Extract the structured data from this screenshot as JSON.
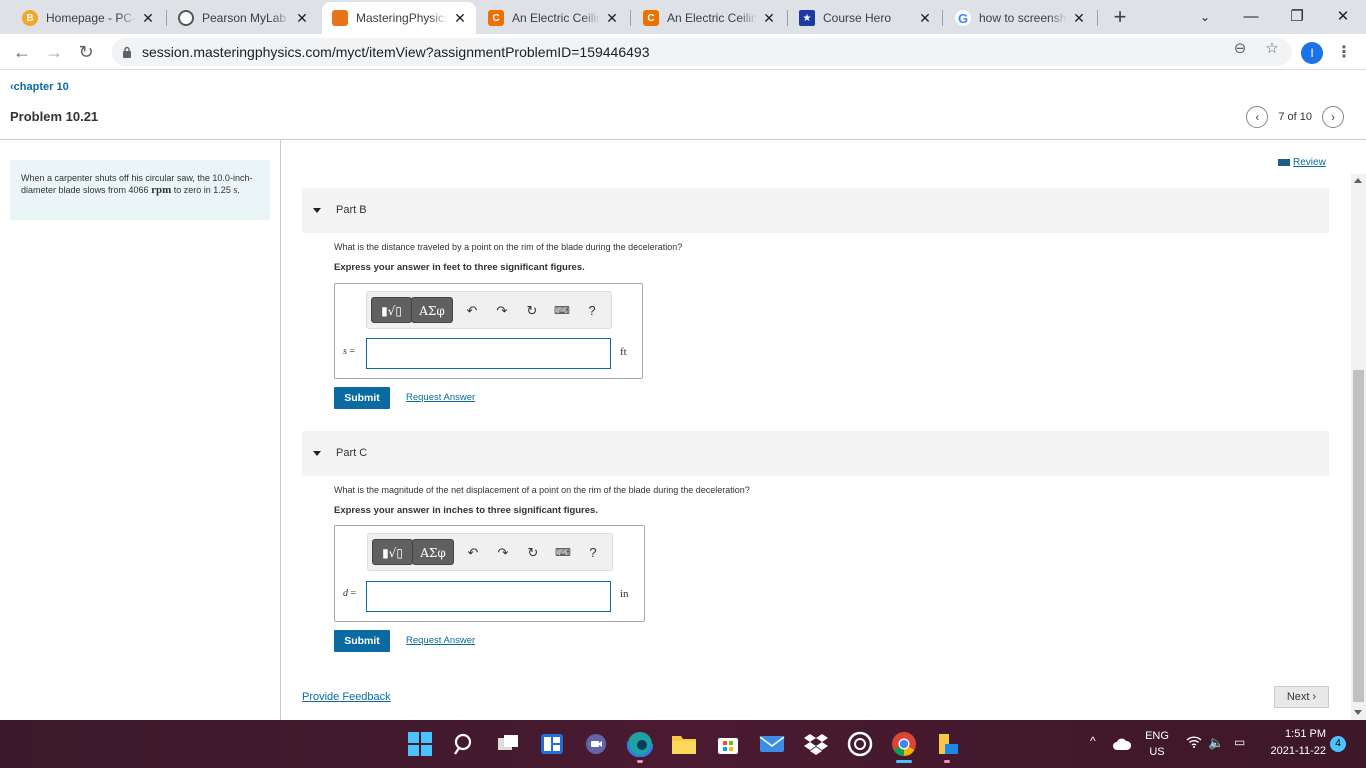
{
  "browser": {
    "tabs": [
      {
        "title": "Homepage - PC-",
        "favicon": "orange-b-icon",
        "active": false
      },
      {
        "title": "Pearson MyLab and",
        "favicon": "pearson-icon",
        "active": false
      },
      {
        "title": "MasteringPhysics",
        "favicon": "mastering-icon",
        "active": true
      },
      {
        "title": "An Electric Ceiling",
        "favicon": "chegg-icon",
        "active": false
      },
      {
        "title": "An Electric Ceiling",
        "favicon": "chegg-icon",
        "active": false
      },
      {
        "title": "Course Hero",
        "favicon": "coursehero-icon",
        "active": false
      },
      {
        "title": "how to screenshot",
        "favicon": "google-icon",
        "active": false
      }
    ],
    "url": "session.masteringphysics.com/myct/itemView?assignmentProblemID=159446493",
    "profile_initial": "I"
  },
  "page": {
    "back_link": "chapter 10",
    "problem_title": "Problem 10.21",
    "pager": "7 of 10",
    "review": "Review",
    "problem": {
      "text_a": "When a carpenter shuts off his circular saw, the 10.0-inch-diameter blade slows from 4066",
      "unit_rpm": "rpm",
      "text_b": "to zero in 1.25",
      "unit_s": "s",
      "text_c": "."
    },
    "parts": [
      {
        "label": "Part B",
        "question": "What is the distance traveled by a point on the rim of the blade during the deceleration?",
        "instruction": "Express your answer in feet to three significant figures.",
        "variable": "s",
        "unit": "ft",
        "value": "",
        "submit": "Submit",
        "request": "Request Answer"
      },
      {
        "label": "Part C",
        "question": "What is the magnitude of the net displacement of a point on the rim of the blade during the deceleration?",
        "instruction": "Express your answer in inches to three significant figures.",
        "variable": "d",
        "unit": "in",
        "value": "",
        "submit": "Submit",
        "request": "Request Answer"
      }
    ],
    "toolbar": {
      "greek": "ΑΣφ",
      "help": "?"
    },
    "feedback": "Provide Feedback",
    "next": "Next"
  },
  "taskbar": {
    "lang": "ENG",
    "region": "US",
    "time": "1:51 PM",
    "date": "2021-11-22",
    "notifications": "4"
  },
  "colors": {
    "accent": "#0a6aa1",
    "problem_bg": "#e9f5f7",
    "taskbar": "#3a1a2a"
  }
}
